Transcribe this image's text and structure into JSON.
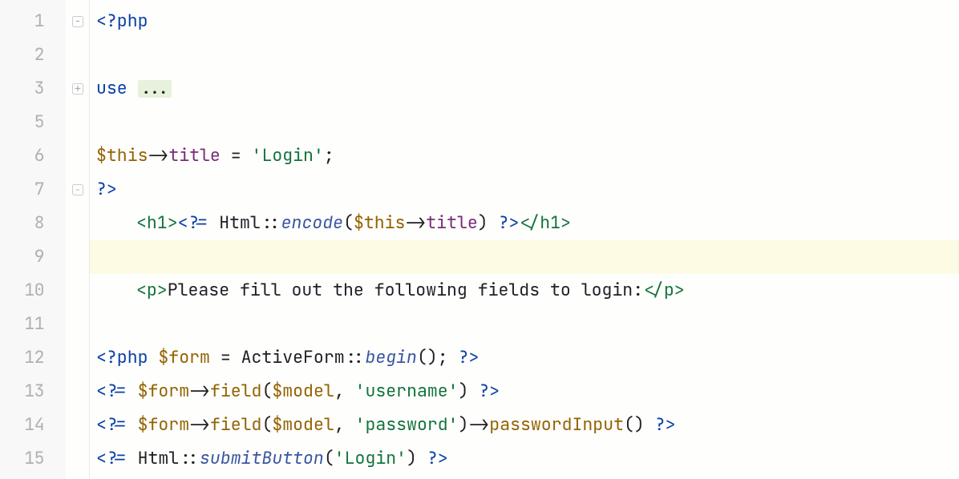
{
  "line_numbers": [
    "1",
    "2",
    "3",
    "5",
    "6",
    "7",
    "8",
    "9",
    "10",
    "11",
    "12",
    "13",
    "14",
    "15"
  ],
  "folds": {
    "line1": "minus",
    "line3": "plus",
    "line7": "rgn"
  },
  "code": {
    "l1": {
      "a": "<?php"
    },
    "l3": {
      "a": "use ",
      "chip": "..."
    },
    "l6": {
      "a": "$this",
      "b": "->",
      "c": "title",
      "d": " = ",
      "e": "'Login'",
      "f": ";"
    },
    "l7": {
      "a": "?>"
    },
    "l8": {
      "a": "<h1>",
      "b": "<?= ",
      "c": "Html",
      "d": "::",
      "e": "encode",
      "f": "(",
      "g": "$this",
      "h": "->",
      "i": "title",
      "j": ") ",
      "k": "?>",
      "l": "</h1>"
    },
    "l10": {
      "a": "<p>",
      "b": "Please fill out the following fields to login:",
      "c": "</p>"
    },
    "l12": {
      "a": "<?php ",
      "b": "$form",
      "c": " = ",
      "d": "ActiveForm",
      "e": "::",
      "f": "begin",
      "g": "(); ",
      "h": "?>"
    },
    "l13": {
      "a": "<?= ",
      "b": "$form",
      "c": "->",
      "d": "field",
      "e": "(",
      "f": "$model",
      "g": ", ",
      "h": "'username'",
      "i": ") ",
      "j": "?>"
    },
    "l14": {
      "a": "<?= ",
      "b": "$form",
      "c": "->",
      "d": "field",
      "e": "(",
      "f": "$model",
      "g": ", ",
      "h": "'password'",
      "i": ")->",
      "j": "passwordInput",
      "k": "() ",
      "l": "?>"
    },
    "l15": {
      "a": "<?= ",
      "b": "Html",
      "c": "::",
      "d": "submitButton",
      "e": "(",
      "f": "'Login'",
      "g": ") ",
      "h": "?>"
    }
  }
}
